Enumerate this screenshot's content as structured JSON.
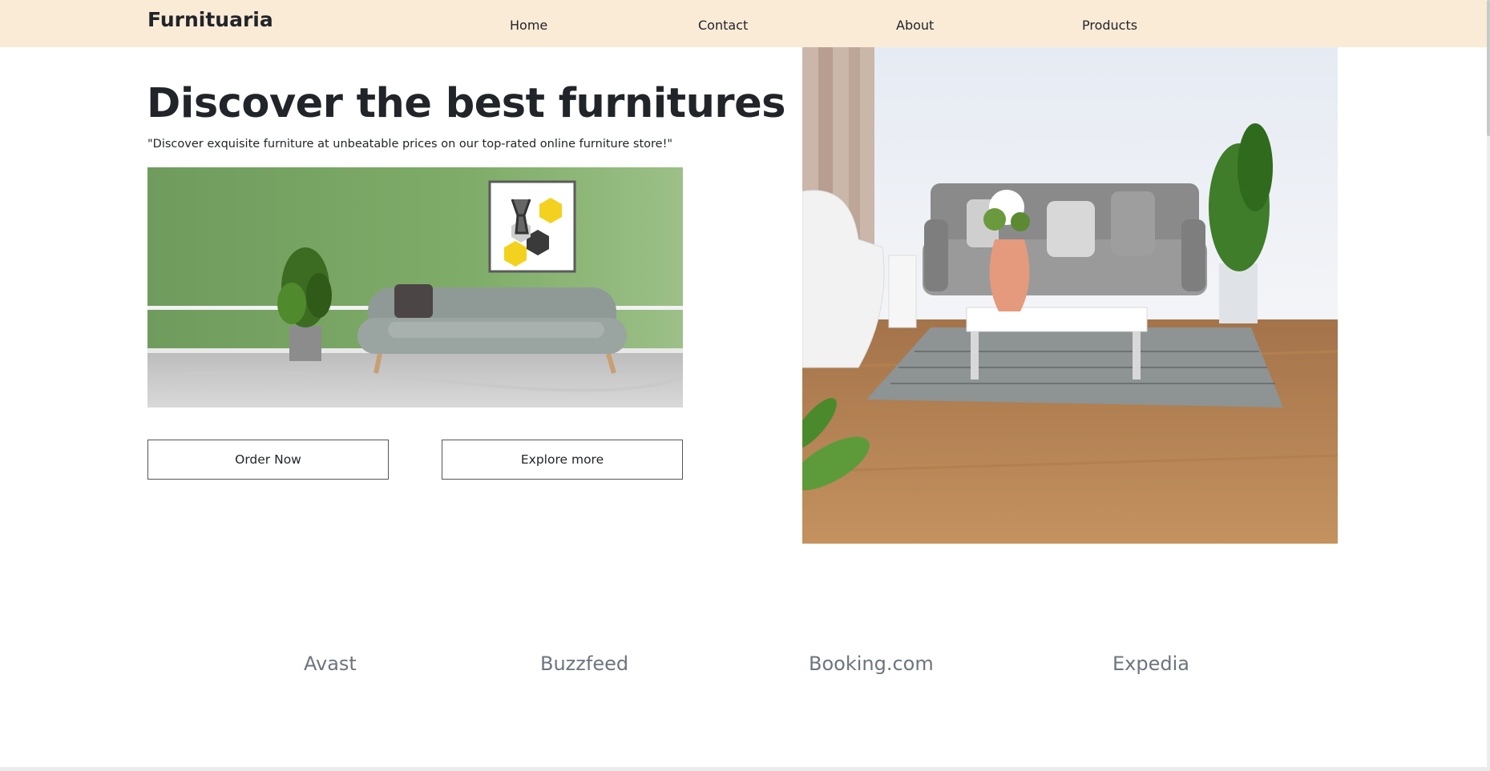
{
  "nav": {
    "brand": "Furnituaria",
    "links": [
      "Home",
      "Contact",
      "About",
      "Products"
    ]
  },
  "hero": {
    "title": "Discover the best furnitures",
    "subtitle": "\"Discover exquisite furniture at unbeatable prices on our top-rated online furniture store!\"",
    "buttons": {
      "order": "Order Now",
      "explore": "Explore more"
    }
  },
  "brands": [
    "Avast",
    "Buzzfeed",
    "Booking.com",
    "Expedia"
  ],
  "colors": {
    "navbar_bg": "#faebd7",
    "text": "#212529",
    "muted_text": "#6c757d",
    "wall_green": "#7fac68",
    "sofa_grey": "#8f9a96",
    "wood_floor": "#b98353"
  },
  "images": {
    "left": "illustrated-living-room-green-wall-grey-sofa",
    "right": "living-room-photo-grey-sofa-wood-floor"
  }
}
